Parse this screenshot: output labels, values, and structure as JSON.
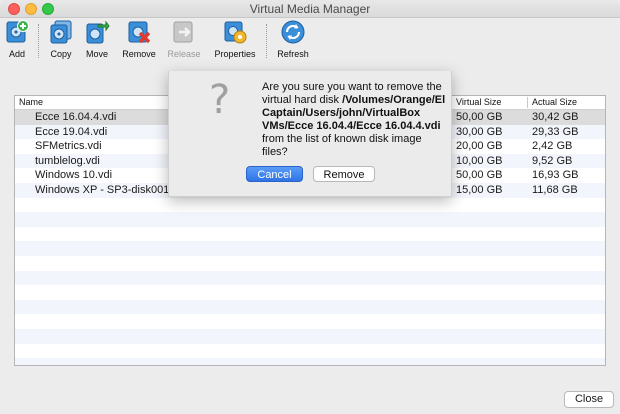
{
  "window": {
    "title": "Virtual Media Manager"
  },
  "toolbar": {
    "items": [
      {
        "label": "Add",
        "icon": "add-disk-icon"
      },
      {
        "label": "Copy",
        "icon": "copy-disk-icon"
      },
      {
        "label": "Move",
        "icon": "move-disk-icon"
      },
      {
        "label": "Remove",
        "icon": "remove-disk-icon"
      },
      {
        "label": "Release",
        "icon": "release-disk-icon",
        "disabled": true
      },
      {
        "label": "Properties",
        "icon": "properties-icon"
      },
      {
        "label": "Refresh",
        "icon": "refresh-icon"
      }
    ]
  },
  "table": {
    "headers": {
      "name": "Name",
      "virtual_size": "Virtual Size",
      "actual_size": "Actual Size"
    },
    "rows": [
      {
        "name": "Ecce 16.04.4.vdi",
        "virtual_size": "50,00 GB",
        "actual_size": "30,42 GB",
        "selected": true
      },
      {
        "name": "Ecce 19.04.vdi",
        "virtual_size": "30,00 GB",
        "actual_size": "29,33 GB"
      },
      {
        "name": "SFMetrics.vdi",
        "virtual_size": "20,00 GB",
        "actual_size": "2,42 GB"
      },
      {
        "name": "tumblelog.vdi",
        "virtual_size": "10,00 GB",
        "actual_size": "9,52 GB"
      },
      {
        "name": "Windows 10.vdi",
        "virtual_size": "50,00 GB",
        "actual_size": "16,93 GB"
      },
      {
        "name": "Windows XP - SP3-disk001.",
        "virtual_size": "15,00 GB",
        "actual_size": "11,68 GB"
      }
    ]
  },
  "dialog": {
    "icon": "question-mark-icon",
    "message_prefix": "Are you sure you want to remove the virtual hard disk ",
    "message_path": "/Volumes/Orange/El Captain/Users/john/VirtualBox VMs/Ecce 16.04.4/Ecce 16.04.4.vdi",
    "message_suffix": " from the list of known disk image files?",
    "cancel_label": "Cancel",
    "remove_label": "Remove"
  },
  "footer": {
    "close_label": "Close"
  },
  "colors": {
    "accent": "#2f74e8",
    "selection": "#dcdcdc",
    "stripe": "#f2f5fb"
  }
}
